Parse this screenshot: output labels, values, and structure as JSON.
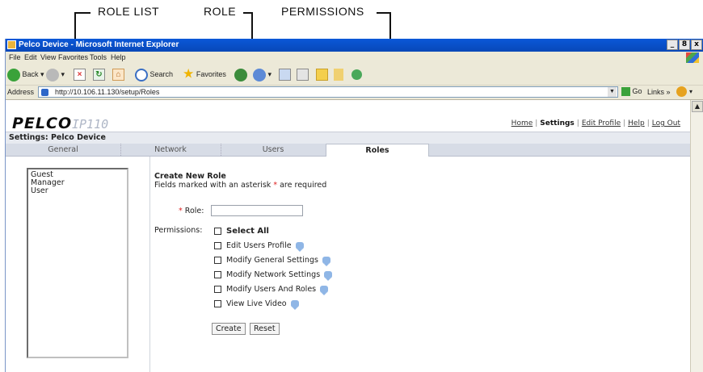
{
  "callouts": [
    "ROLE LIST",
    "ROLE",
    "PERMISSIONS"
  ],
  "browser": {
    "title": "Pelco Device - Microsoft Internet Explorer",
    "window_buttons": [
      "_",
      "8",
      "x"
    ],
    "menu": [
      "File",
      "Edit",
      "View",
      "Favorites",
      "Tools",
      "Help"
    ],
    "toolbar": {
      "back": "Back",
      "search": "Search",
      "favorites": "Favorites"
    },
    "address_label": "Address",
    "address_value": "http://10.106.11.130/setup/Roles",
    "go": "Go",
    "links": "Links",
    "links_chevron": "»"
  },
  "page": {
    "logo": "PELCO",
    "model": "IP110",
    "top_links": [
      "Home",
      "Settings",
      "Edit Profile",
      "Help",
      "Log Out"
    ],
    "settings_title": "Settings: Pelco Device",
    "tabs": [
      "General",
      "Network",
      "Users",
      "Roles"
    ],
    "active_tab": "Roles",
    "roles": [
      "Guest",
      "Manager",
      "User"
    ],
    "form": {
      "heading": "Create New Role",
      "note_before": "Fields marked with an asterisk ",
      "note_star": "*",
      "note_after": " are required",
      "role_star": "*",
      "role_label": "Role:",
      "role_value": "",
      "permissions_label": "Permissions:",
      "select_all": "Select All",
      "permissions": [
        "Edit Users Profile",
        "Modify General Settings",
        "Modify Network Settings",
        "Modify Users And Roles",
        "View Live Video"
      ],
      "create_button": "Create",
      "reset_button": "Reset"
    }
  }
}
